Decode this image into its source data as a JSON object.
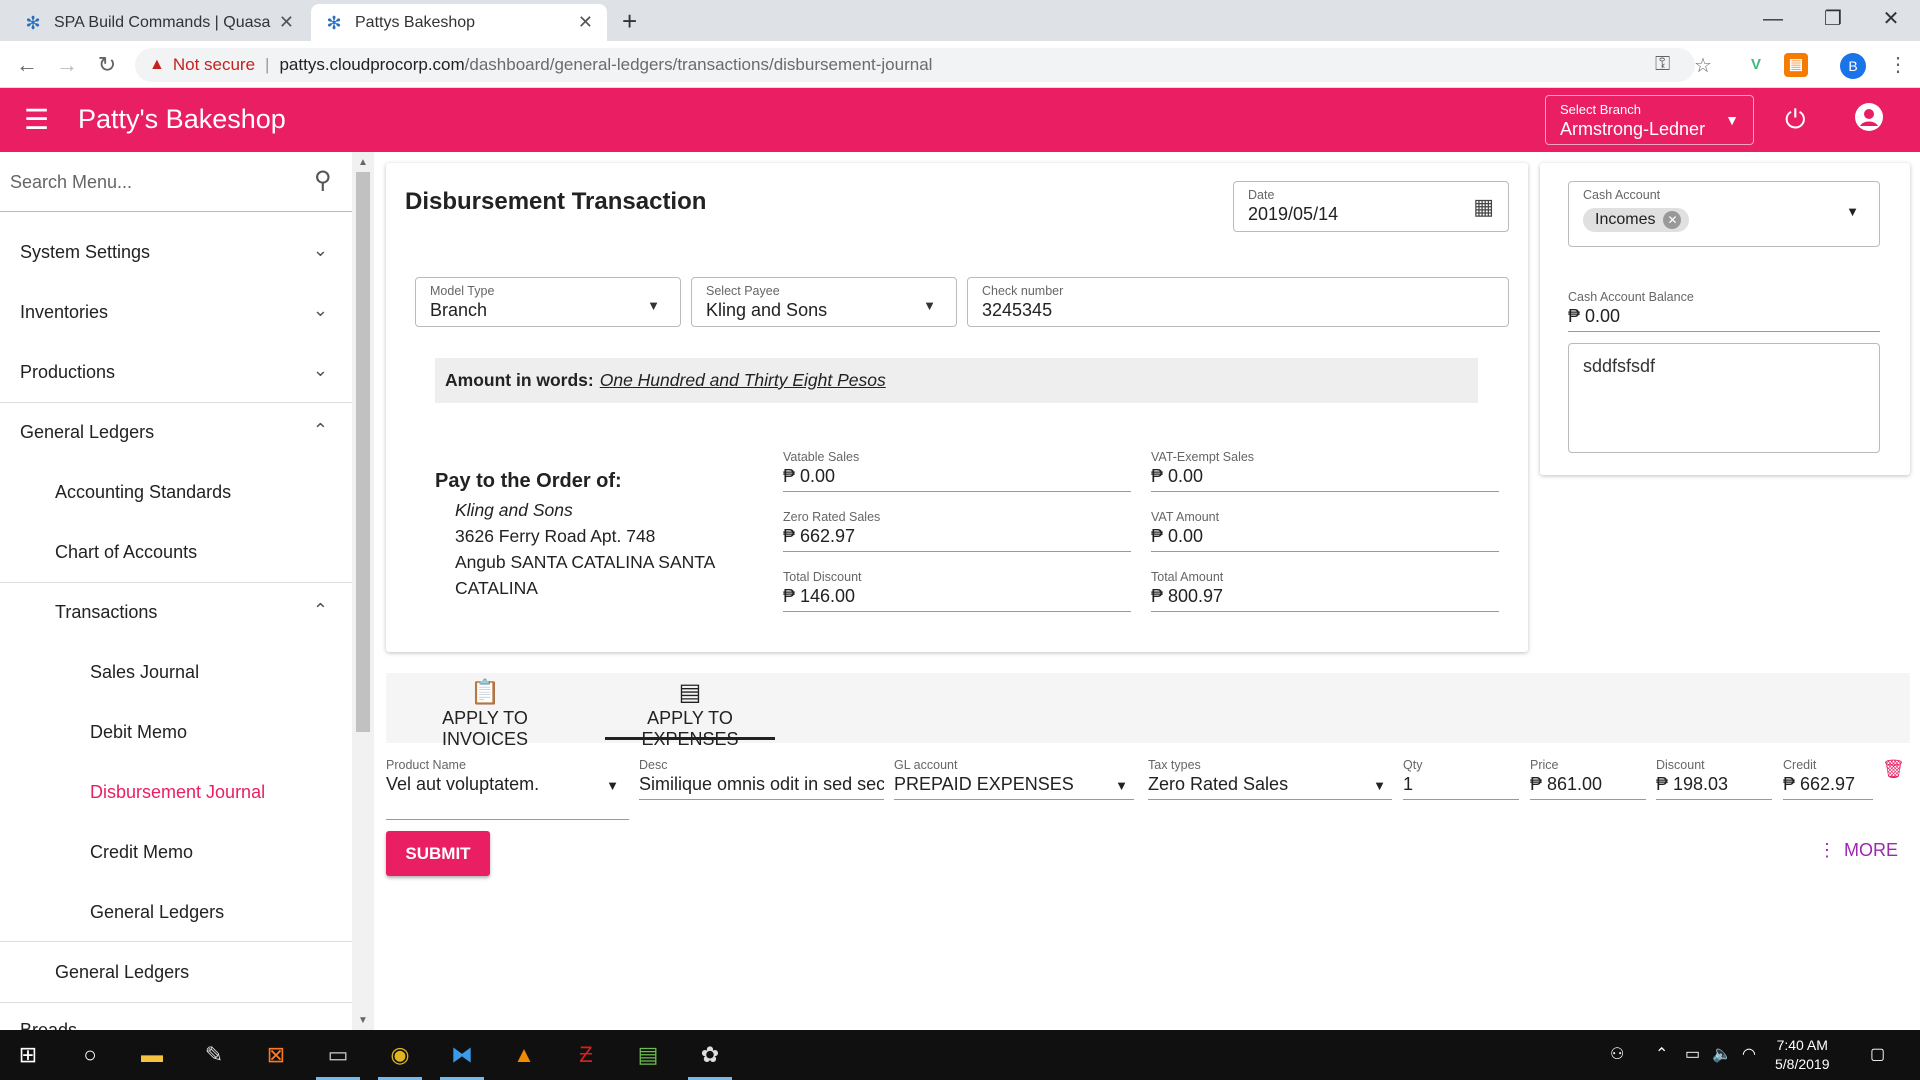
{
  "browser": {
    "tabs": [
      {
        "title": "SPA Build Commands | Quasar Fr"
      },
      {
        "title": "Pattys Bakeshop"
      }
    ],
    "url_security": "Not secure",
    "url_host": "pattys.cloudprocorp.com",
    "url_path": "/dashboard/general-ledgers/transactions/disbursement-journal",
    "profile_initial": "B"
  },
  "app": {
    "title": "Patty's Bakeshop",
    "branch_label": "Select Branch",
    "branch_value": "Armstrong-Ledner",
    "accent_color": "#e91e63"
  },
  "sidebar": {
    "search_placeholder": "Search Menu...",
    "items": [
      {
        "label": "System Settings",
        "level": 0,
        "expanded": false
      },
      {
        "label": "Inventories",
        "level": 0,
        "expanded": false
      },
      {
        "label": "Productions",
        "level": 0,
        "expanded": false
      },
      {
        "label": "General Ledgers",
        "level": 0,
        "expanded": true
      },
      {
        "label": "Accounting Standards",
        "level": 1
      },
      {
        "label": "Chart of Accounts",
        "level": 1
      },
      {
        "label": "Transactions",
        "level": 1,
        "expanded": true
      },
      {
        "label": "Sales Journal",
        "level": 2
      },
      {
        "label": "Debit Memo",
        "level": 2
      },
      {
        "label": "Disbursement Journal",
        "level": 2,
        "active": true
      },
      {
        "label": "Credit Memo",
        "level": 2
      },
      {
        "label": "General Ledgers",
        "level": 2
      },
      {
        "label": "General Ledgers",
        "level": 1
      },
      {
        "label": "Breads",
        "level": 0
      }
    ]
  },
  "form": {
    "title": "Disbursement Transaction",
    "date_label": "Date",
    "date_value": "2019/05/14",
    "model_type_label": "Model Type",
    "model_type_value": "Branch",
    "payee_label": "Select Payee",
    "payee_value": "Kling and Sons",
    "check_label": "Check number",
    "check_value": "3245345",
    "amount_words_label": "Amount in words:",
    "amount_words_value": "One Hundred and Thirty Eight Pesos",
    "pay_order_label": "Pay to the Order of:",
    "payee_name": "Kling and Sons",
    "address_line1": "3626 Ferry Road Apt. 748",
    "address_line2": "Angub SANTA CATALINA SANTA",
    "address_line3": "CATALINA",
    "totals": {
      "vatable_label": "Vatable Sales",
      "vatable_value": "₱ 0.00",
      "vat_exempt_label": "VAT-Exempt Sales",
      "vat_exempt_value": "₱ 0.00",
      "zero_rated_label": "Zero Rated Sales",
      "zero_rated_value": "₱ 662.97",
      "vat_amount_label": "VAT Amount",
      "vat_amount_value": "₱ 0.00",
      "total_discount_label": "Total Discount",
      "total_discount_value": "₱ 146.00",
      "total_amount_label": "Total Amount",
      "total_amount_value": "₱ 800.97"
    }
  },
  "side_panel": {
    "cash_account_label": "Cash Account",
    "cash_account_chip": "Incomes",
    "balance_label": "Cash Account Balance",
    "balance_value": "₱ 0.00",
    "notes_value": "sddfsfsdf"
  },
  "tabs": {
    "invoices_label": "APPLY TO INVOICES",
    "expenses_label": "APPLY TO EXPENSES",
    "active": "expenses"
  },
  "expense_row": {
    "product_label": "Product Name",
    "product_value": "Vel aut voluptatem.",
    "desc_label": "Desc",
    "desc_value": "Similique omnis odit in sed sec",
    "gl_label": "GL account",
    "gl_value": "PREPAID EXPENSES",
    "tax_label": "Tax types",
    "tax_value": "Zero Rated Sales",
    "qty_label": "Qty",
    "qty_value": "1",
    "price_label": "Price",
    "price_value": "₱ 861.00",
    "discount_label": "Discount",
    "discount_value": "₱ 198.03",
    "credit_label": "Credit",
    "credit_value": "₱ 662.97"
  },
  "actions": {
    "submit_label": "SUBMIT",
    "more_label": "MORE"
  },
  "taskbar": {
    "time": "7:40 AM",
    "date": "5/8/2019"
  }
}
